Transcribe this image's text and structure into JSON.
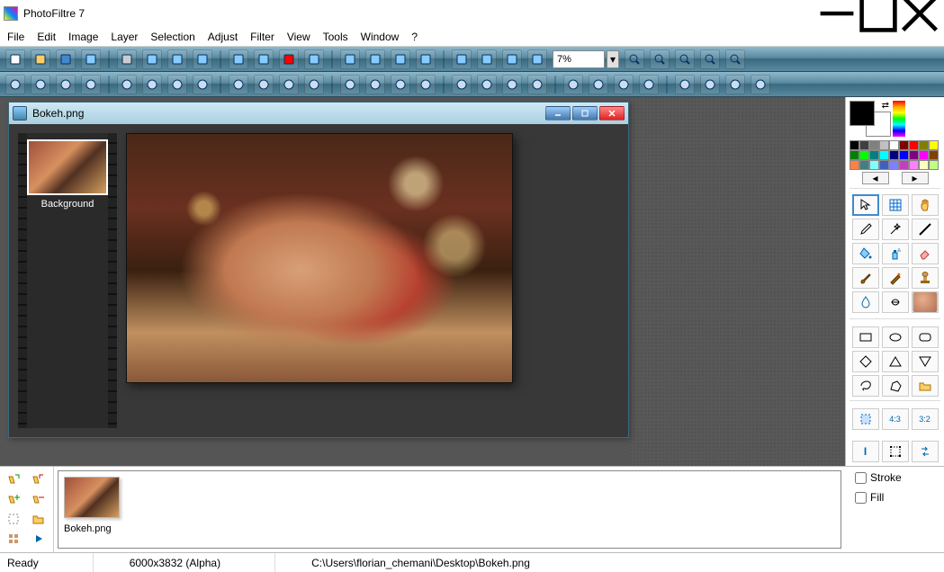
{
  "app": {
    "title": "PhotoFiltre 7"
  },
  "menu": [
    "File",
    "Edit",
    "Image",
    "Layer",
    "Selection",
    "Adjust",
    "Filter",
    "View",
    "Tools",
    "Window",
    "?"
  ],
  "zoom": {
    "value": "7%"
  },
  "document": {
    "title": "Bokeh.png",
    "layer_label": "Background"
  },
  "tray": {
    "item_label": "Bokeh.png"
  },
  "right_panel": {
    "stroke_label": "Stroke",
    "fill_label": "Fill",
    "palette_rows": [
      [
        "#000000",
        "#404040",
        "#808080",
        "#c0c0c0",
        "#ffffff",
        "#800000",
        "#ff0000",
        "#808000",
        "#ffff00"
      ],
      [
        "#008000",
        "#00ff00",
        "#008080",
        "#00ffff",
        "#000080",
        "#0000ff",
        "#800080",
        "#ff00ff",
        "#804000"
      ],
      [
        "#ff8040",
        "#408080",
        "#80ffff",
        "#4060c0",
        "#8080ff",
        "#c040c0",
        "#ff80ff",
        "#ffffc0",
        "#c0ff80"
      ]
    ]
  },
  "status": {
    "ready": "Ready",
    "dims": "6000x3832 (Alpha)",
    "path": "C:\\Users\\florian_chemani\\Desktop\\Bokeh.png"
  },
  "toolbar1_icons": [
    "new",
    "open",
    "save",
    "save-as",
    "print",
    "scan",
    "undo",
    "redo",
    "copy",
    "paste",
    "rgb",
    "histogram",
    "move",
    "image-size",
    "canvas-size",
    "flip",
    "text",
    "layers",
    "sparkle",
    "module"
  ],
  "toolbar2_icons": [
    "bright-minus",
    "bright-plus",
    "contrast-minus",
    "contrast-plus",
    "gamma-minus",
    "gamma-plus",
    "sat-minus",
    "sat-plus",
    "hue-left",
    "hue-right",
    "auto-level",
    "auto-contrast",
    "gray",
    "sepia",
    "blur-less",
    "blur-more",
    "drop1",
    "drop2",
    "sharpen1",
    "sharpen2",
    "relief",
    "gradient",
    "dither",
    "invert",
    "frame",
    "clipboard",
    "export",
    "batch"
  ],
  "zoom_icons": [
    "zoom-in",
    "zoom-out",
    "fit",
    "actual",
    "fullscreen"
  ]
}
